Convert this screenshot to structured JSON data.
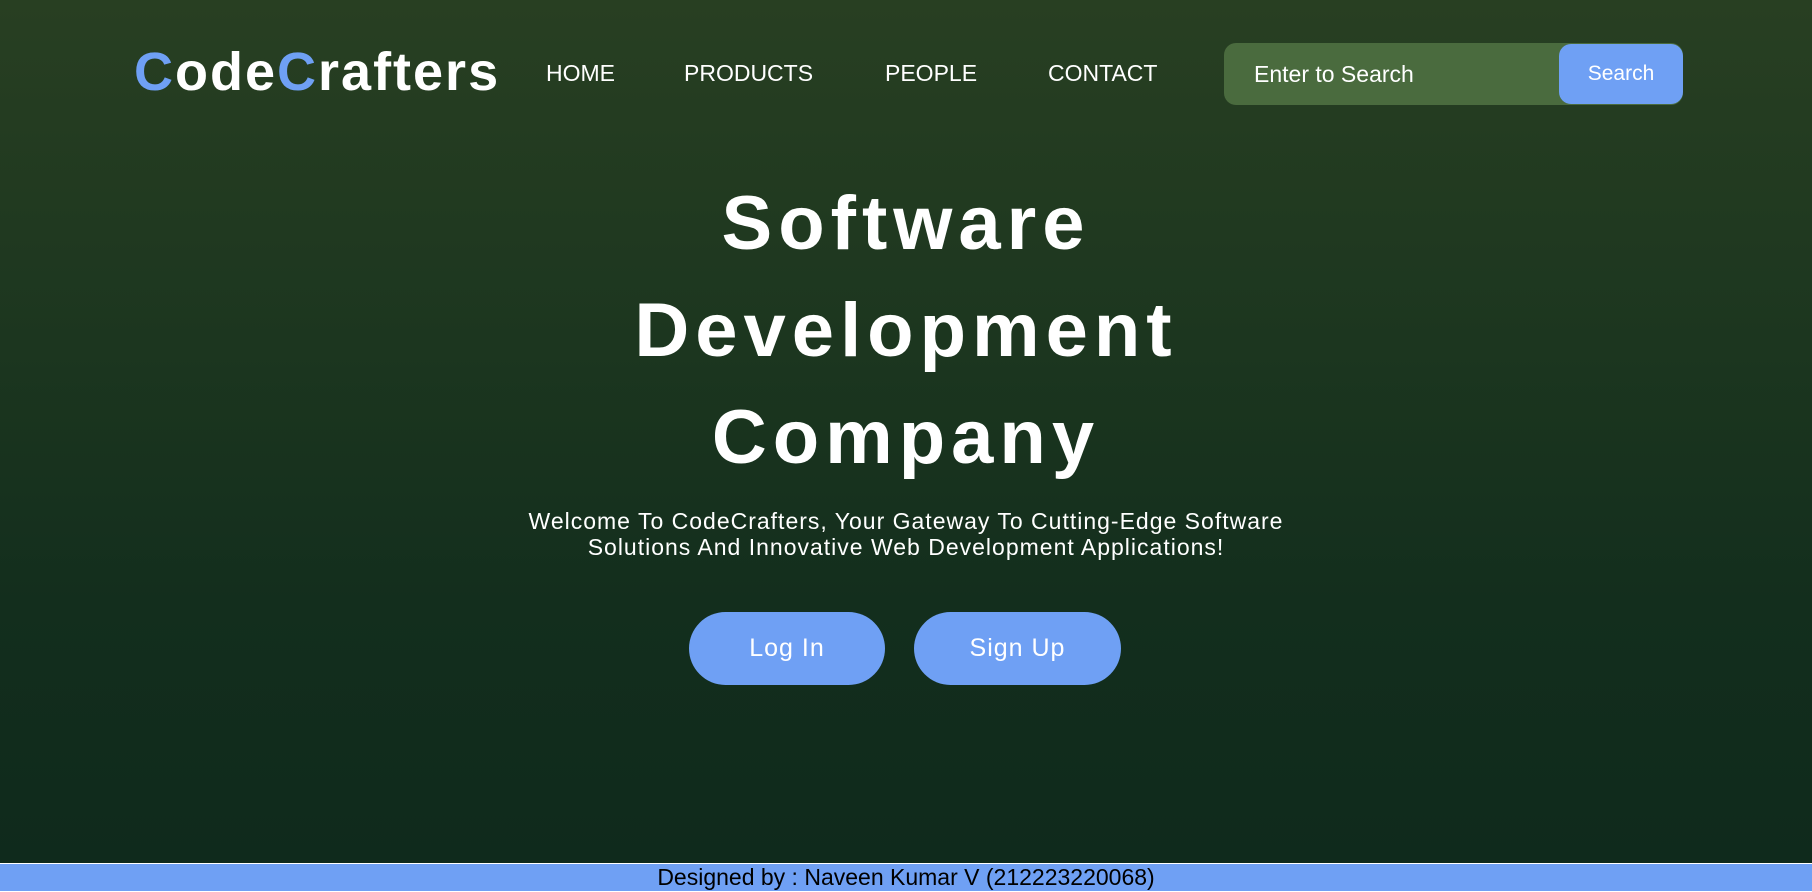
{
  "header": {
    "logo": {
      "part1_accent": "C",
      "part1_rest": "ode",
      "part2_accent": "C",
      "part2_rest": "rafters"
    },
    "nav": {
      "home": "HOME",
      "products": "PRODUCTS",
      "people": "PEOPLE",
      "contact": "CONTACT"
    },
    "search": {
      "placeholder": "Enter to Search",
      "value": "",
      "button_label": "Search"
    }
  },
  "hero": {
    "title_lines": [
      "Software",
      "Development",
      "Company"
    ],
    "subtitle_line1": "Welcome To CodeCrafters, Your Gateway To Cutting-Edge Software",
    "subtitle_line2": "Solutions And Innovative Web Development Applications!",
    "login_label": "Log In",
    "signup_label": "Sign Up"
  },
  "footer": {
    "text": "Designed by : Naveen Kumar V (212223220068)"
  },
  "colors": {
    "accent": "#6fa0f4",
    "background_top": "#283f22",
    "background_bottom": "#0f2a1c",
    "search_box": "#4a6b3e",
    "text": "#ffffff"
  }
}
